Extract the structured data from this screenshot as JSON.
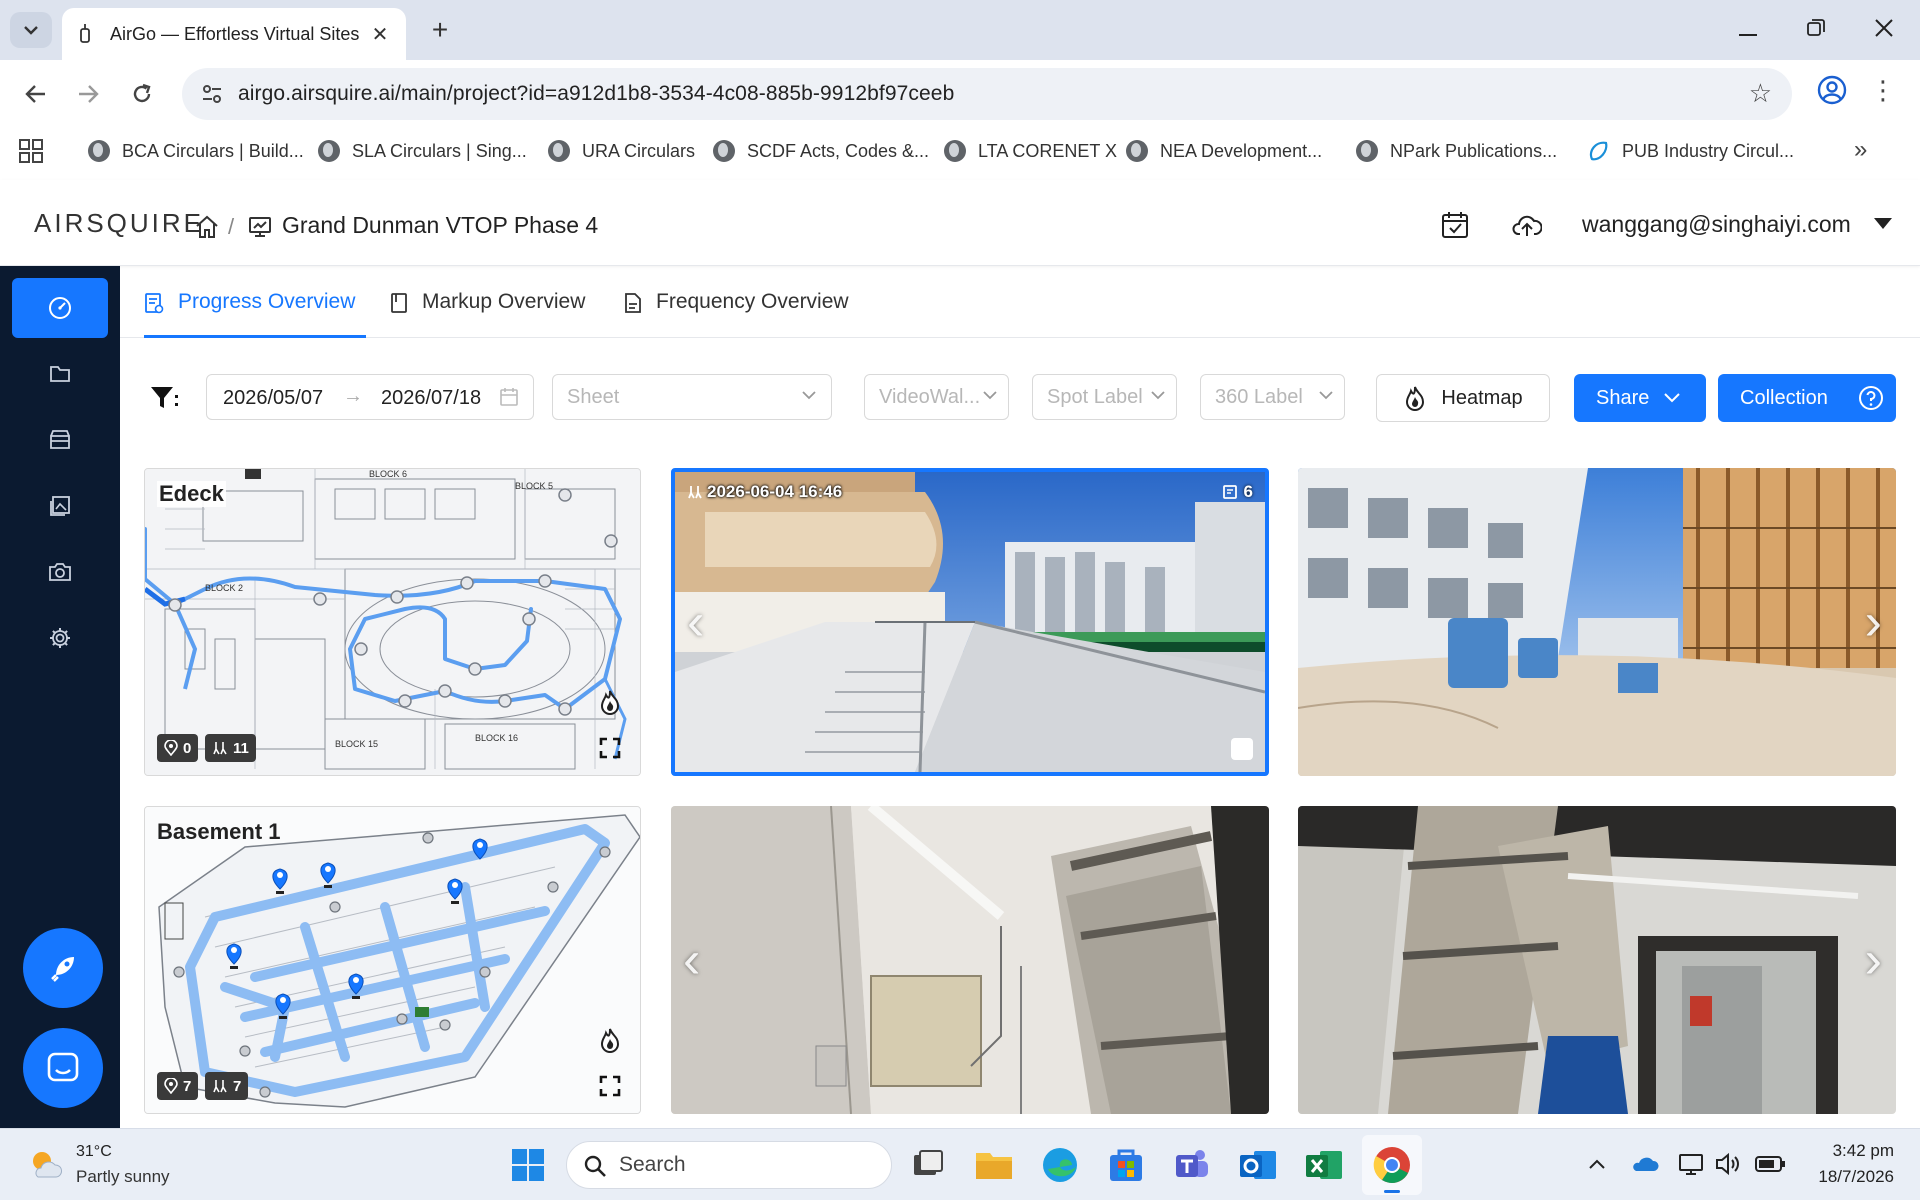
{
  "browser": {
    "tab_title": "AirGo — Effortless Virtual Sites",
    "url": "airgo.airsquire.ai/main/project?id=a912d1b8-3534-4c08-885b-9912bf97ceeb",
    "bookmarks": [
      "BCA Circulars | Build...",
      "SLA Circulars | Sing...",
      "URA Circulars",
      "SCDF Acts, Codes &...",
      "LTA CORENET X",
      "NEA Development...",
      "NPark Publications...",
      "PUB Industry Circul..."
    ]
  },
  "app": {
    "logo": "AIRSQUIRE",
    "project_name": "Grand Dunman VTOP Phase 4",
    "user_email": "wanggang@singhaiyi.com",
    "tabs": [
      "Progress Overview",
      "Markup Overview",
      "Frequency Overview"
    ],
    "active_tab": 0,
    "accent_color": "#1677ff",
    "sidebar_color": "#0b1a30"
  },
  "filters": {
    "date_start": "2026/05/07",
    "date_end": "2026/07/18",
    "sheet_placeholder": "Sheet",
    "videowalk_placeholder": "VideoWal...",
    "spot_label_placeholder": "Spot Label",
    "label360_placeholder": "360 Label",
    "heatmap_label": "Heatmap",
    "share_label": "Share",
    "collection_label": "Collection"
  },
  "sheets": [
    {
      "title": "Edeck",
      "spot_count": "0",
      "walk_count": "11",
      "photos": [
        {
          "timestamp": "2026-06-04 16:46",
          "markup_count": "6",
          "selected": true
        },
        {
          "timestamp": "",
          "markup_count": "",
          "selected": false
        }
      ]
    },
    {
      "title": "Basement 1",
      "spot_count": "7",
      "walk_count": "7",
      "photos": [
        {
          "timestamp": "",
          "markup_count": "",
          "selected": false
        },
        {
          "timestamp": "",
          "markup_count": "",
          "selected": false
        }
      ]
    }
  ],
  "taskbar": {
    "temperature": "31°C",
    "condition": "Partly sunny",
    "search_placeholder": "Search",
    "time": "3:42 pm",
    "date": "18/7/2026"
  }
}
